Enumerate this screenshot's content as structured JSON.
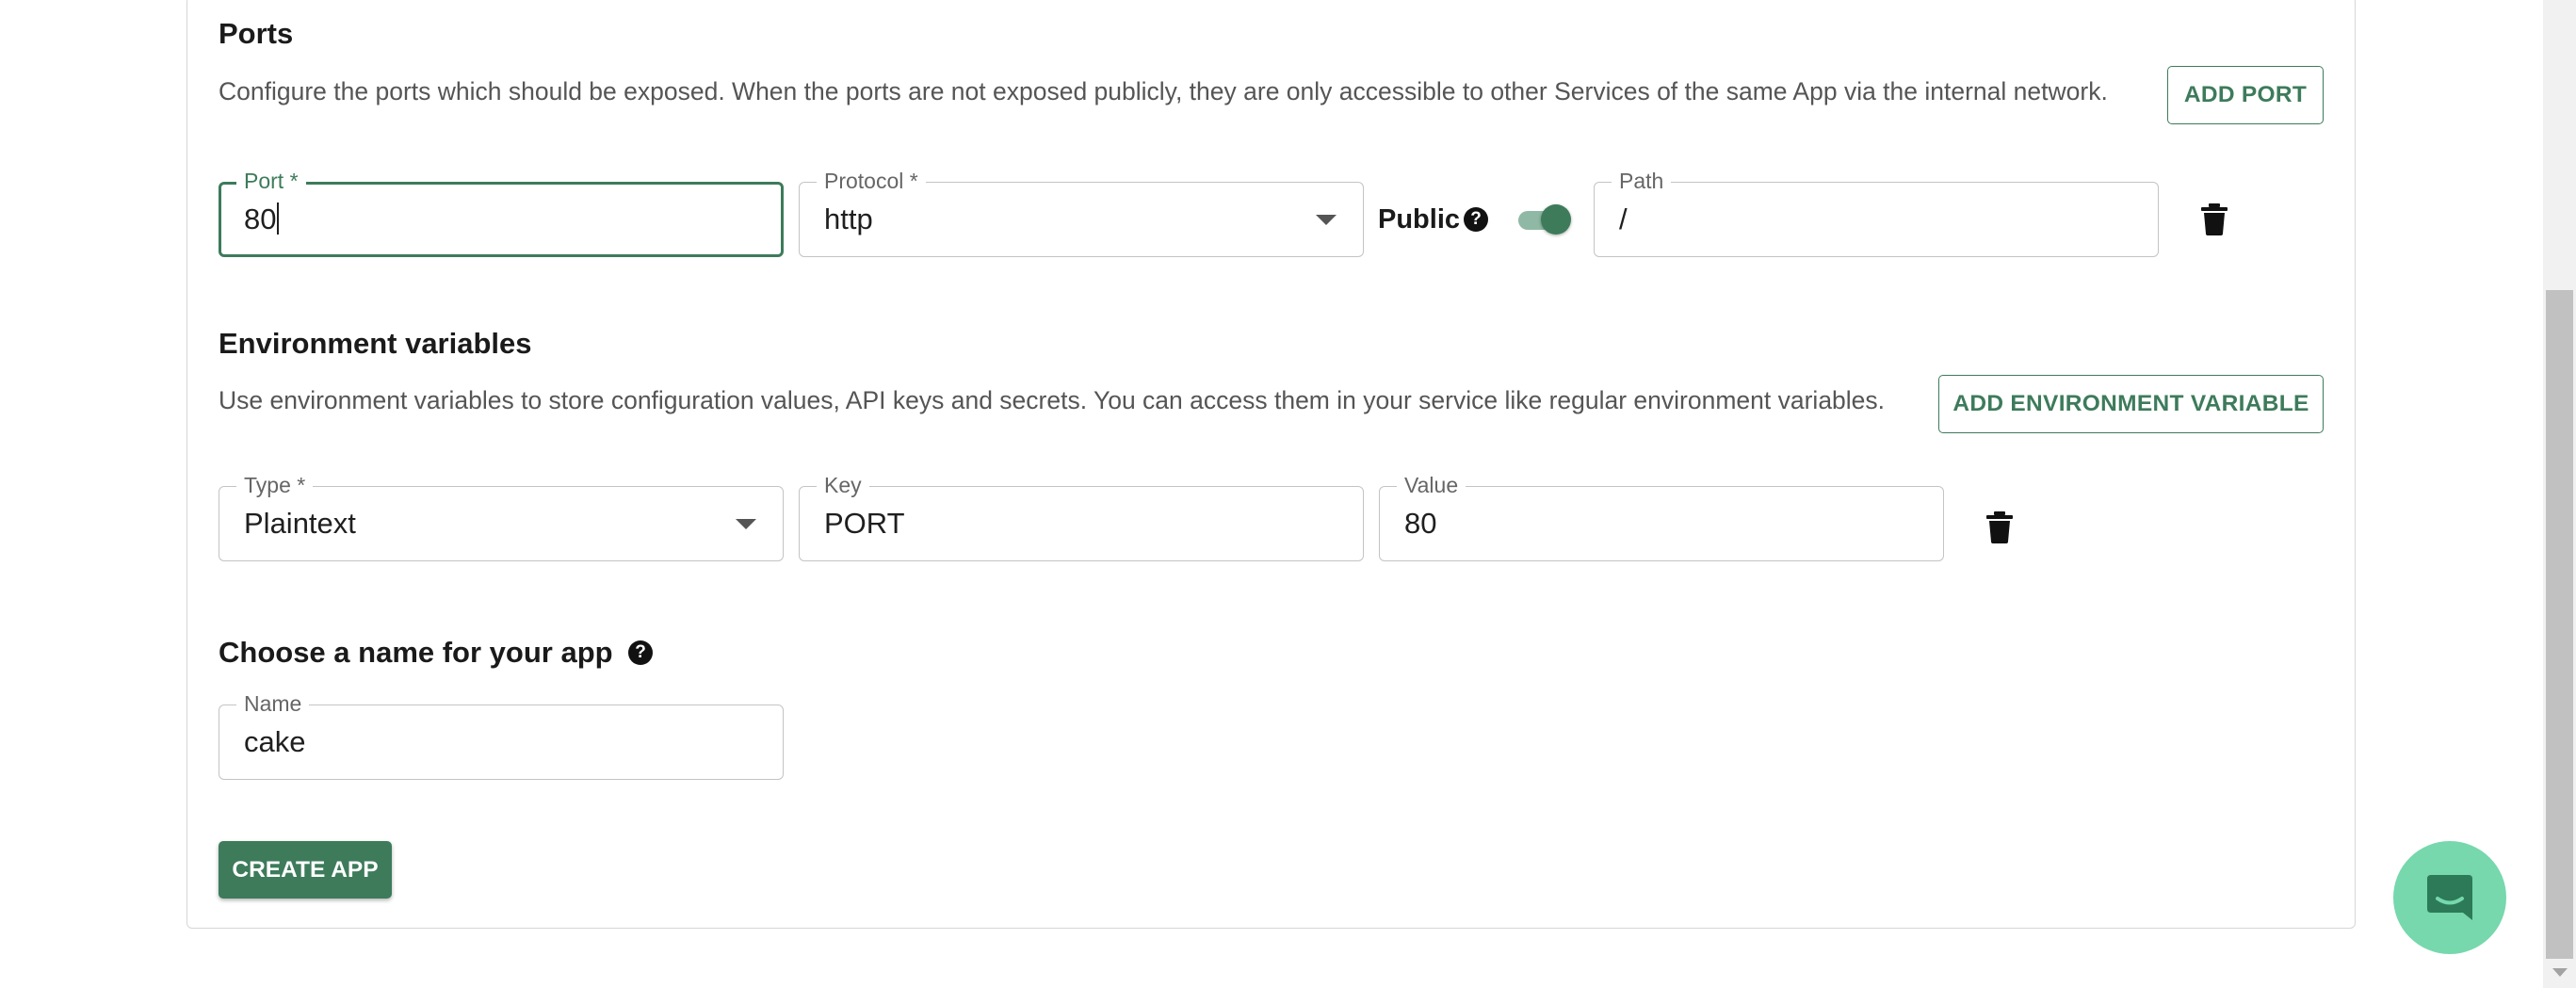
{
  "ports": {
    "title": "Ports",
    "description": "Configure the ports which should be exposed. When the ports are not exposed publicly, they are only accessible to other Services of the same App via the internal network.",
    "add_button": "ADD PORT",
    "port_label": "Port *",
    "port_value": "80",
    "protocol_label": "Protocol *",
    "protocol_value": "http",
    "public_label": "Public",
    "public_enabled": true,
    "path_label": "Path",
    "path_value": "/"
  },
  "env": {
    "title": "Environment variables",
    "description": "Use environment variables to store configuration values, API keys and secrets. You can access them in your service like regular environment variables.",
    "add_button": "ADD ENVIRONMENT VARIABLE",
    "type_label": "Type *",
    "type_value": "Plaintext",
    "key_label": "Key",
    "key_value": "PORT",
    "value_label": "Value",
    "value_value": "80"
  },
  "app_name": {
    "title": "Choose a name for your app",
    "name_label": "Name",
    "name_value": "cake"
  },
  "create_button": "CREATE APP",
  "icons": {
    "help": "question-circle-icon",
    "delete": "trash-icon",
    "dropdown": "caret-down-icon",
    "chat": "chat-bubble-icon"
  },
  "colors": {
    "accent": "#3d7b5b",
    "chat_launcher": "#76d8ac"
  }
}
